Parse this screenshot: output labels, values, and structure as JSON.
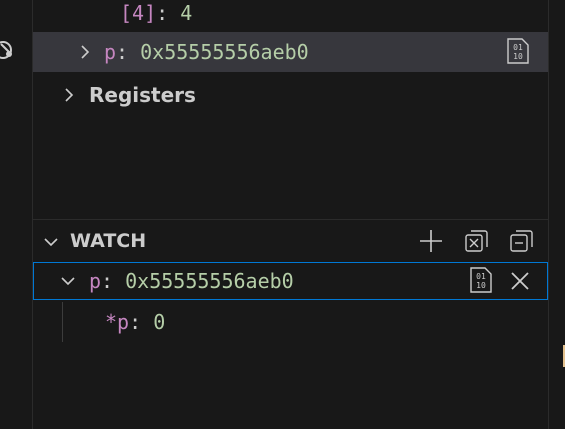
{
  "variables": {
    "index_item": {
      "key": "[4]",
      "separator": ": ",
      "value": "4"
    },
    "selected_item": {
      "key": "p",
      "separator": ": ",
      "value": "0x55555556aeb0",
      "binary_icon": "binary-view-icon"
    },
    "registers": {
      "label": "Registers"
    }
  },
  "watch": {
    "title": "WATCH",
    "actions": {
      "add": "add-expression-icon",
      "collapse": "collapse-all-icon",
      "remove_all": "remove-all-icon"
    },
    "items": [
      {
        "key": "p",
        "separator": ": ",
        "value": "0x55555556aeb0",
        "children": [
          {
            "key": "*p",
            "separator": ": ",
            "value": "0"
          }
        ]
      }
    ]
  },
  "colors": {
    "background": "#181818",
    "selected_row": "#37373d",
    "focus_border": "#0078d4",
    "variable_name": "#c586c0",
    "number_value": "#b5cea8",
    "foreground": "#cccccc"
  }
}
